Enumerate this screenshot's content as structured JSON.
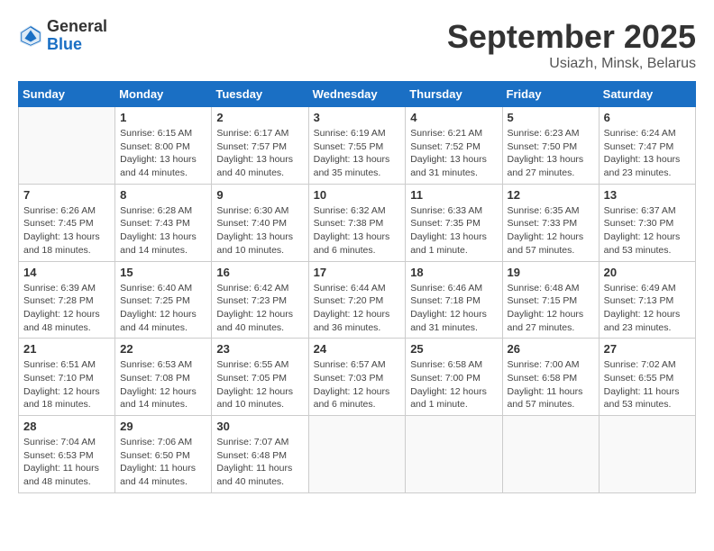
{
  "header": {
    "logo": {
      "general": "General",
      "blue": "Blue"
    },
    "title": "September 2025",
    "subtitle": "Usiazh, Minsk, Belarus"
  },
  "weekdays": [
    "Sunday",
    "Monday",
    "Tuesday",
    "Wednesday",
    "Thursday",
    "Friday",
    "Saturday"
  ],
  "weeks": [
    [
      {
        "day": "",
        "empty": true
      },
      {
        "day": "1",
        "sunrise": "6:15 AM",
        "sunset": "8:00 PM",
        "daylight": "13 hours and 44 minutes."
      },
      {
        "day": "2",
        "sunrise": "6:17 AM",
        "sunset": "7:57 PM",
        "daylight": "13 hours and 40 minutes."
      },
      {
        "day": "3",
        "sunrise": "6:19 AM",
        "sunset": "7:55 PM",
        "daylight": "13 hours and 35 minutes."
      },
      {
        "day": "4",
        "sunrise": "6:21 AM",
        "sunset": "7:52 PM",
        "daylight": "13 hours and 31 minutes."
      },
      {
        "day": "5",
        "sunrise": "6:23 AM",
        "sunset": "7:50 PM",
        "daylight": "13 hours and 27 minutes."
      },
      {
        "day": "6",
        "sunrise": "6:24 AM",
        "sunset": "7:47 PM",
        "daylight": "13 hours and 23 minutes."
      }
    ],
    [
      {
        "day": "7",
        "sunrise": "6:26 AM",
        "sunset": "7:45 PM",
        "daylight": "13 hours and 18 minutes."
      },
      {
        "day": "8",
        "sunrise": "6:28 AM",
        "sunset": "7:43 PM",
        "daylight": "13 hours and 14 minutes."
      },
      {
        "day": "9",
        "sunrise": "6:30 AM",
        "sunset": "7:40 PM",
        "daylight": "13 hours and 10 minutes."
      },
      {
        "day": "10",
        "sunrise": "6:32 AM",
        "sunset": "7:38 PM",
        "daylight": "13 hours and 6 minutes."
      },
      {
        "day": "11",
        "sunrise": "6:33 AM",
        "sunset": "7:35 PM",
        "daylight": "13 hours and 1 minute."
      },
      {
        "day": "12",
        "sunrise": "6:35 AM",
        "sunset": "7:33 PM",
        "daylight": "12 hours and 57 minutes."
      },
      {
        "day": "13",
        "sunrise": "6:37 AM",
        "sunset": "7:30 PM",
        "daylight": "12 hours and 53 minutes."
      }
    ],
    [
      {
        "day": "14",
        "sunrise": "6:39 AM",
        "sunset": "7:28 PM",
        "daylight": "12 hours and 48 minutes."
      },
      {
        "day": "15",
        "sunrise": "6:40 AM",
        "sunset": "7:25 PM",
        "daylight": "12 hours and 44 minutes."
      },
      {
        "day": "16",
        "sunrise": "6:42 AM",
        "sunset": "7:23 PM",
        "daylight": "12 hours and 40 minutes."
      },
      {
        "day": "17",
        "sunrise": "6:44 AM",
        "sunset": "7:20 PM",
        "daylight": "12 hours and 36 minutes."
      },
      {
        "day": "18",
        "sunrise": "6:46 AM",
        "sunset": "7:18 PM",
        "daylight": "12 hours and 31 minutes."
      },
      {
        "day": "19",
        "sunrise": "6:48 AM",
        "sunset": "7:15 PM",
        "daylight": "12 hours and 27 minutes."
      },
      {
        "day": "20",
        "sunrise": "6:49 AM",
        "sunset": "7:13 PM",
        "daylight": "12 hours and 23 minutes."
      }
    ],
    [
      {
        "day": "21",
        "sunrise": "6:51 AM",
        "sunset": "7:10 PM",
        "daylight": "12 hours and 18 minutes."
      },
      {
        "day": "22",
        "sunrise": "6:53 AM",
        "sunset": "7:08 PM",
        "daylight": "12 hours and 14 minutes."
      },
      {
        "day": "23",
        "sunrise": "6:55 AM",
        "sunset": "7:05 PM",
        "daylight": "12 hours and 10 minutes."
      },
      {
        "day": "24",
        "sunrise": "6:57 AM",
        "sunset": "7:03 PM",
        "daylight": "12 hours and 6 minutes."
      },
      {
        "day": "25",
        "sunrise": "6:58 AM",
        "sunset": "7:00 PM",
        "daylight": "12 hours and 1 minute."
      },
      {
        "day": "26",
        "sunrise": "7:00 AM",
        "sunset": "6:58 PM",
        "daylight": "11 hours and 57 minutes."
      },
      {
        "day": "27",
        "sunrise": "7:02 AM",
        "sunset": "6:55 PM",
        "daylight": "11 hours and 53 minutes."
      }
    ],
    [
      {
        "day": "28",
        "sunrise": "7:04 AM",
        "sunset": "6:53 PM",
        "daylight": "11 hours and 48 minutes."
      },
      {
        "day": "29",
        "sunrise": "7:06 AM",
        "sunset": "6:50 PM",
        "daylight": "11 hours and 44 minutes."
      },
      {
        "day": "30",
        "sunrise": "7:07 AM",
        "sunset": "6:48 PM",
        "daylight": "11 hours and 40 minutes."
      },
      {
        "day": "",
        "empty": true
      },
      {
        "day": "",
        "empty": true
      },
      {
        "day": "",
        "empty": true
      },
      {
        "day": "",
        "empty": true
      }
    ]
  ],
  "labels": {
    "sunrise": "Sunrise:",
    "sunset": "Sunset:",
    "daylight": "Daylight:"
  }
}
